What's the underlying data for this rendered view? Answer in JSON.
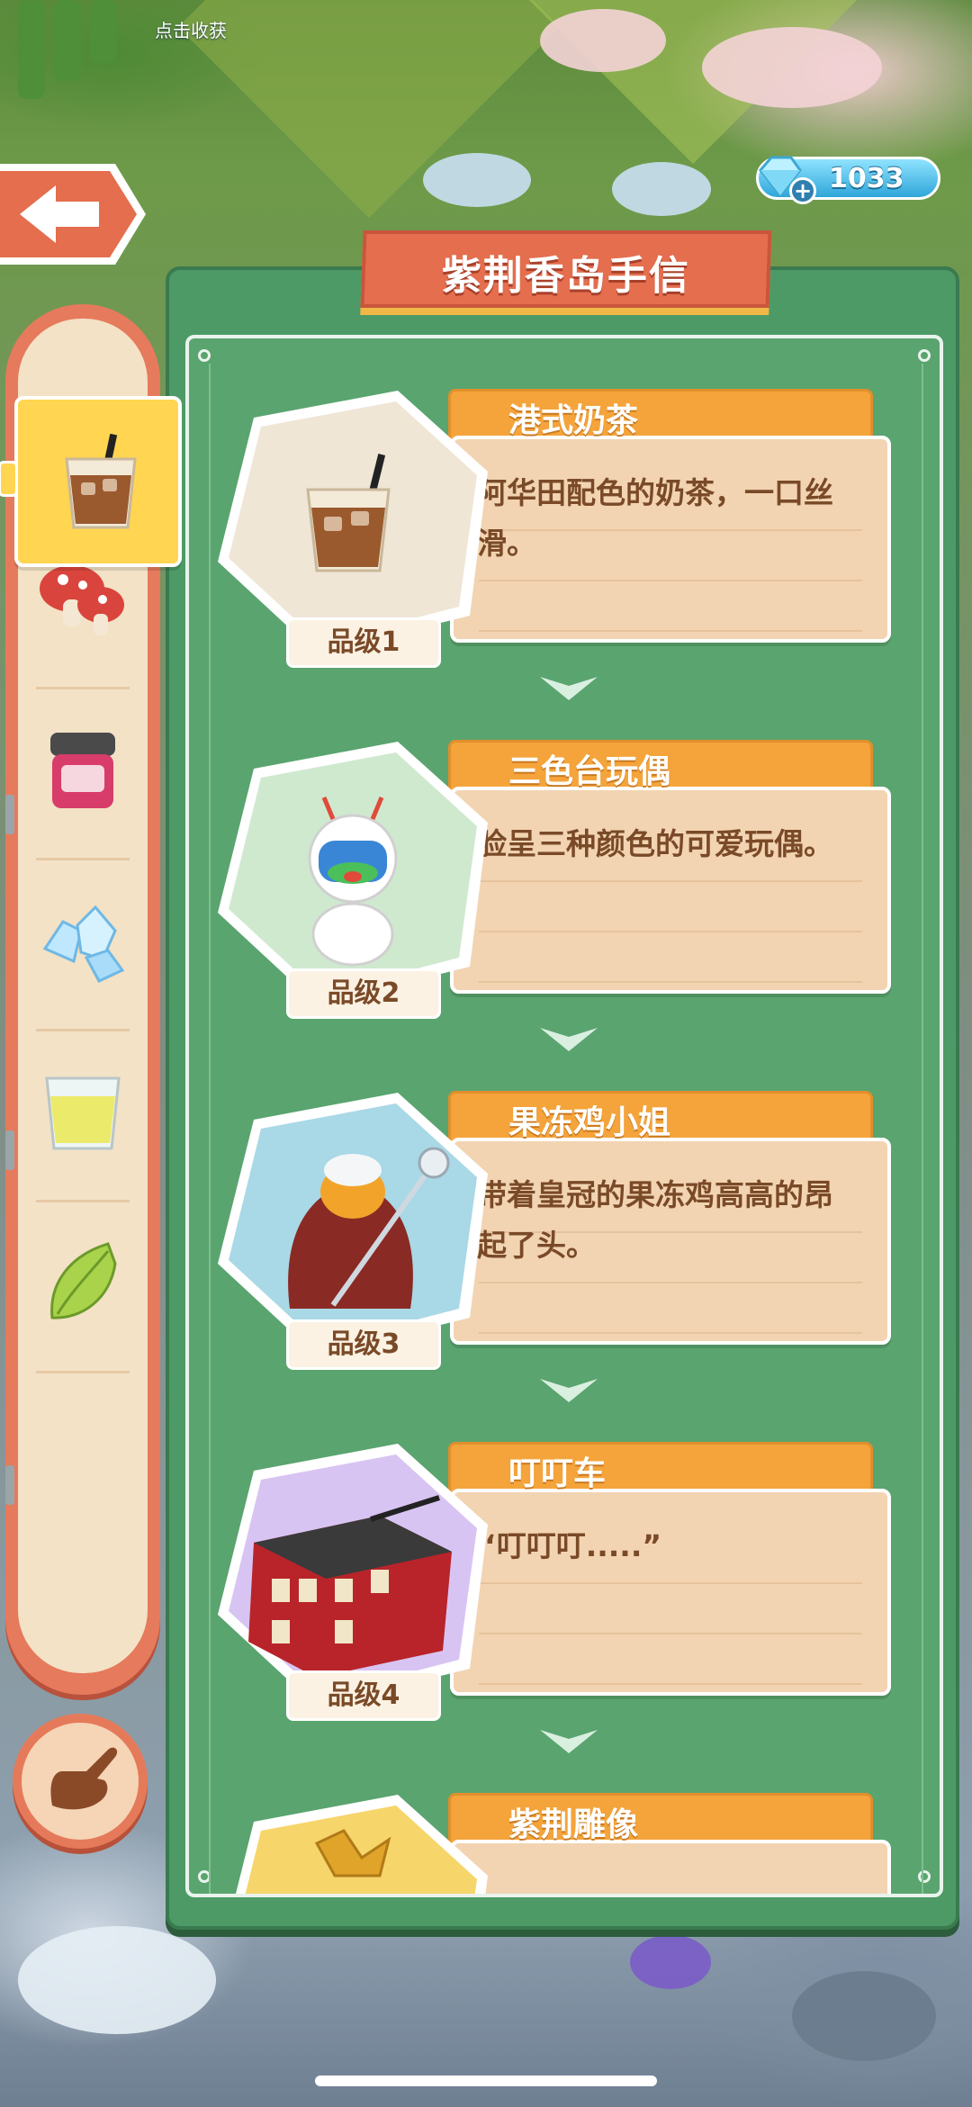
{
  "header": {
    "harvest_hint": "点击收获",
    "currency_amount": "1033",
    "title": "紫荆香岛手信"
  },
  "sidebar": {
    "items": [
      {
        "icon": "milk-tea-icon",
        "active": true
      },
      {
        "icon": "mushroom-icon",
        "active": false
      },
      {
        "icon": "jam-jar-icon",
        "active": false
      },
      {
        "icon": "crystal-icon",
        "active": false
      },
      {
        "icon": "juice-glass-icon",
        "active": false
      },
      {
        "icon": "bamboo-shoot-icon",
        "active": false
      }
    ]
  },
  "cards": [
    {
      "name": "港式奶茶",
      "desc": "阿华田配色的奶茶，一口丝滑。",
      "tier": "品级1",
      "icon": "milk-tea-icon",
      "bg": "#efe6d6"
    },
    {
      "name": "三色台玩偶",
      "desc": "脸呈三种颜色的可爱玩偶。",
      "tier": "品级2",
      "icon": "robot-doll-icon",
      "bg": "#cfe9cf"
    },
    {
      "name": "果冻鸡小姐",
      "desc": "带着皇冠的果冻鸡高高的昂起了头。",
      "tier": "品级3",
      "icon": "jelly-chicken-icon",
      "bg": "#a9d8e6"
    },
    {
      "name": "叮叮车",
      "desc": "“叮叮叮.....”",
      "tier": "品级4",
      "icon": "tram-icon",
      "bg": "#d8c4f2"
    },
    {
      "name": "紫荆雕像",
      "desc": "",
      "tier": "",
      "icon": "bauhinia-statue-icon",
      "bg": "#f6d56a"
    }
  ],
  "colors": {
    "panel_green": "#4d9a66",
    "title_red": "#e46e4e",
    "tab_orange": "#f4a43b",
    "desc_beige": "#f2d4b2",
    "text_brown": "#7a4a28"
  }
}
